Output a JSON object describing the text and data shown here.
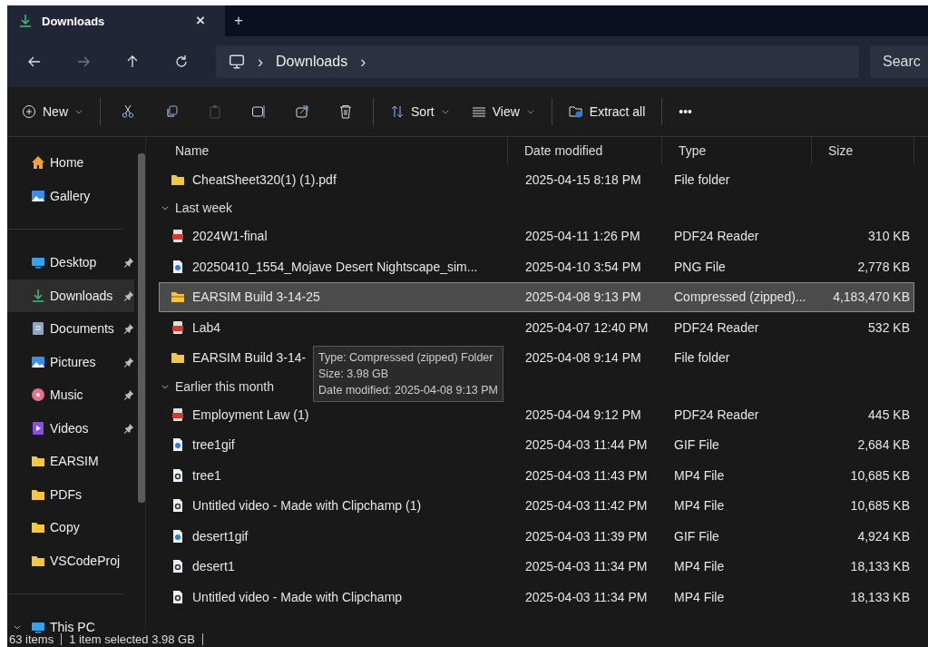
{
  "tab": {
    "title": "Downloads",
    "close": "×",
    "new_tab": "+"
  },
  "address": {
    "crumbs": [
      "Downloads"
    ],
    "separator": "›",
    "search_placeholder": "Searc"
  },
  "toolbar": [
    {
      "kind": "new",
      "label": "New",
      "dropdown": true,
      "disabled": false
    },
    {
      "kind": "cut",
      "disabled": false
    },
    {
      "kind": "copy",
      "disabled": false
    },
    {
      "kind": "paste",
      "disabled": true
    },
    {
      "kind": "rename",
      "disabled": false
    },
    {
      "kind": "share",
      "disabled": false
    },
    {
      "kind": "delete",
      "disabled": false
    },
    {
      "kind": "sort",
      "label": "Sort",
      "dropdown": true,
      "disabled": false
    },
    {
      "kind": "view",
      "label": "View",
      "dropdown": true,
      "disabled": false
    },
    {
      "kind": "extract",
      "label": "Extract all",
      "dropdown": false,
      "disabled": false
    },
    {
      "kind": "more",
      "label": "•••",
      "dropdown": false,
      "disabled": false
    }
  ],
  "sidebar": [
    {
      "kind": "home",
      "label": "Home",
      "pinned": false,
      "selected": false
    },
    {
      "kind": "gallery",
      "label": "Gallery",
      "pinned": false,
      "selected": false
    },
    {
      "kind": "desktop",
      "label": "Desktop",
      "pinned": true,
      "selected": false
    },
    {
      "kind": "download",
      "label": "Downloads",
      "pinned": true,
      "selected": true
    },
    {
      "kind": "documents",
      "label": "Documents",
      "pinned": true,
      "selected": false
    },
    {
      "kind": "gallery",
      "label": "Pictures",
      "pinned": true,
      "selected": false
    },
    {
      "kind": "music",
      "label": "Music",
      "pinned": true,
      "selected": false
    },
    {
      "kind": "videos",
      "label": "Videos",
      "pinned": true,
      "selected": false
    },
    {
      "kind": "folder",
      "label": "EARSIM",
      "pinned": false,
      "selected": false
    },
    {
      "kind": "folder",
      "label": "PDFs",
      "pinned": false,
      "selected": false
    },
    {
      "kind": "folder",
      "label": "Copy",
      "pinned": false,
      "selected": false
    },
    {
      "kind": "folder",
      "label": "VSCodeProj",
      "pinned": false,
      "selected": false
    },
    {
      "kind": "desktop",
      "label": "This PC",
      "pinned": false,
      "selected": false,
      "expanded": true
    }
  ],
  "columns": [
    "Name",
    "Date modified",
    "Type",
    "Size"
  ],
  "rows": [
    {
      "kind": "folder",
      "name": "CheatSheet320(1) (1).pdf",
      "date": "2025-04-15 8:18 PM",
      "type": "File folder",
      "selected": false
    },
    {
      "kind": "group",
      "name": "Last week",
      "expanded": true
    },
    {
      "kind": "pdf",
      "name": "2024W1-final",
      "date": "2025-04-11 1:26 PM",
      "type": "PDF24 Reader",
      "size": "310 KB",
      "selected": false
    },
    {
      "kind": "image",
      "name": "20250410_1554_Mojave Desert Nightscape_sim...",
      "date": "2025-04-10 3:54 PM",
      "type": "PNG File",
      "size": "2,778 KB",
      "selected": false
    },
    {
      "kind": "zip",
      "name": "EARSIM Build 3-14-25",
      "date": "2025-04-08 9:13 PM",
      "type": "Compressed (zipped)...",
      "size": "4,183,470 KB",
      "selected": true
    },
    {
      "kind": "pdf",
      "name": "Lab4",
      "date": "2025-04-07 12:40 PM",
      "type": "PDF24 Reader",
      "size": "532 KB",
      "selected": false
    },
    {
      "kind": "folder",
      "name": "EARSIM Build 3-14-",
      "date": "2025-04-08 9:14 PM",
      "type": "File folder",
      "selected": false
    },
    {
      "kind": "group",
      "name": "Earlier this month",
      "expanded": true
    },
    {
      "kind": "pdf",
      "name": "Employment Law (1)",
      "date": "2025-04-04 9:12 PM",
      "type": "PDF24 Reader",
      "size": "445 KB",
      "selected": false
    },
    {
      "kind": "image",
      "name": "tree1gif",
      "date": "2025-04-03 11:44 PM",
      "type": "GIF File",
      "size": "2,684 KB",
      "selected": false
    },
    {
      "kind": "video",
      "name": "tree1",
      "date": "2025-04-03 11:43 PM",
      "type": "MP4 File",
      "size": "10,685 KB",
      "selected": false
    },
    {
      "kind": "video",
      "name": "Untitled video - Made with Clipchamp (1)",
      "date": "2025-04-03 11:42 PM",
      "type": "MP4 File",
      "size": "10,685 KB",
      "selected": false
    },
    {
      "kind": "image",
      "name": "desert1gif",
      "date": "2025-04-03 11:39 PM",
      "type": "GIF File",
      "size": "4,924 KB",
      "selected": false
    },
    {
      "kind": "video",
      "name": "desert1",
      "date": "2025-04-03 11:34 PM",
      "type": "MP4 File",
      "size": "18,133 KB",
      "selected": false
    },
    {
      "kind": "video",
      "name": "Untitled video - Made with Clipchamp",
      "date": "2025-04-03 11:34 PM",
      "type": "MP4 File",
      "size": "18,133 KB",
      "selected": false
    }
  ],
  "tooltip": [
    "Type: Compressed (zipped) Folder",
    "Size: 3.98 GB",
    "Date modified: 2025-04-08 9:13 PM"
  ],
  "status_bar": [
    "63 items",
    "1 item selected  3.98 GB"
  ]
}
